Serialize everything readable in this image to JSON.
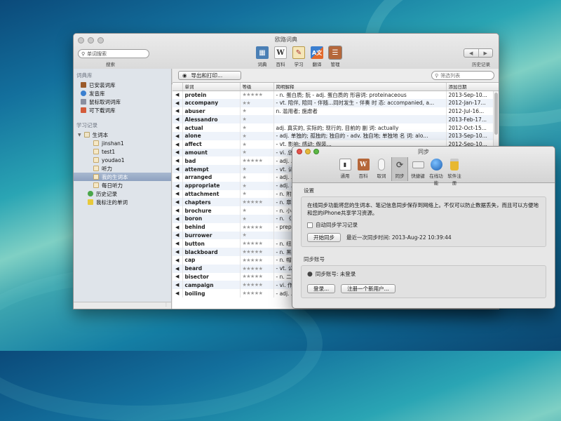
{
  "app": {
    "title": "欧路词典"
  },
  "toolbar": {
    "search_placeholder": "单词搜索",
    "search_caption": "搜索",
    "history_caption": "历史记录",
    "back": "◀",
    "forward": "▶",
    "buttons": [
      {
        "label": "词典",
        "icon": "dictionary-icon"
      },
      {
        "label": "百科",
        "icon": "wikipedia-icon"
      },
      {
        "label": "学习",
        "icon": "study-icon"
      },
      {
        "label": "翻译",
        "icon": "translate-icon"
      },
      {
        "label": "管理",
        "icon": "manage-icon"
      }
    ]
  },
  "sidebar": {
    "section1": "词典库",
    "lib_items": [
      "已安装词库",
      "发音库",
      "鼠标取词词库",
      "可下载词库"
    ],
    "section2": "学习记录",
    "vocab_root": "生词本",
    "vocab_items": [
      "jinshan1",
      "test1",
      "youdao1",
      "听力",
      "我的生词本",
      "每日听力"
    ],
    "other_items": [
      "历史记录",
      "我标注的单词"
    ],
    "selected": "我的生词本"
  },
  "main": {
    "export_label": "导出和打印...",
    "filter_placeholder": "筛选列表",
    "columns": [
      "",
      "单词",
      "等级",
      "简明解释",
      "添加日期"
    ],
    "rows": [
      {
        "word": "protein",
        "stars": "★★★★★",
        "def": "- n. 蛋白质; 朊 - adj. 蛋白质的 形容词: proteinaceous",
        "date": "2013-Sep-10..."
      },
      {
        "word": "accompany",
        "stars": "★★",
        "def": "- vt. 陪伴, 陪同 - 伴随...同时发生 - 伴奏 时 态: accompanied, a...",
        "date": "2012-Jan-17..."
      },
      {
        "word": "abuser",
        "stars": "★",
        "def": "n. 滥用者; 施虐者",
        "date": "2012-Jul-16..."
      },
      {
        "word": "Alessandro",
        "stars": "★",
        "def": "",
        "date": "2013-Feb-17..."
      },
      {
        "word": "actual",
        "stars": "★",
        "def": "adj. 真实的, 实际的; 现行的, 目前的 副 词: actually",
        "date": "2012-Oct-15..."
      },
      {
        "word": "alone",
        "stars": "★",
        "def": "- adj. 单独的; 孤独的; 独自的 - adv. 独自地; 单独地 名 词: alo...",
        "date": "2013-Sep-10..."
      },
      {
        "word": "affect",
        "stars": "★",
        "def": "- vt. 影响; 感动; 假装...",
        "date": "2012-Sep-10..."
      },
      {
        "word": "amount",
        "stars": "★",
        "def": "- vi. 总计...",
        "date": "2012-Sep-16..."
      },
      {
        "word": "bad",
        "stars": "★★★★★",
        "def": "- adj. ...",
        "date": ""
      },
      {
        "word": "attempt",
        "stars": "★",
        "def": "- vt. 试...",
        "date": ""
      },
      {
        "word": "arranged",
        "stars": "★",
        "def": "- adj. ...",
        "date": ""
      },
      {
        "word": "appropriate",
        "stars": "★",
        "def": "- adj. ...",
        "date": ""
      },
      {
        "word": "attachment",
        "stars": "★",
        "def": "- n. 附...",
        "date": ""
      },
      {
        "word": "chapters",
        "stars": "★★★★★",
        "def": "- n. 章...",
        "date": ""
      },
      {
        "word": "brochure",
        "stars": "★",
        "def": "- n. 小...",
        "date": ""
      },
      {
        "word": "boron",
        "stars": "★",
        "def": "- n. 《化...",
        "date": ""
      },
      {
        "word": "behind",
        "stars": "★★★★★",
        "def": "- prep...",
        "date": ""
      },
      {
        "word": "burrower",
        "stars": "★",
        "def": "",
        "date": ""
      },
      {
        "word": "button",
        "stars": "★★★★★",
        "def": "- n. 纽...",
        "date": ""
      },
      {
        "word": "blackboard",
        "stars": "★★★★★",
        "def": "- n. 黑板...",
        "date": ""
      },
      {
        "word": "cap",
        "stars": "★★★★★",
        "def": "- n. 帽...",
        "date": ""
      },
      {
        "word": "beard",
        "stars": "★★★★★",
        "def": "- vt. 公...",
        "date": ""
      },
      {
        "word": "bisector",
        "stars": "★★★★★",
        "def": "- n. 二等...",
        "date": ""
      },
      {
        "word": "campaign",
        "stars": "★★★★★",
        "def": "- vi. 作...",
        "date": ""
      },
      {
        "word": "boiling",
        "stars": "★★★★★",
        "def": "- adj. ...",
        "date": ""
      }
    ]
  },
  "sync_dialog": {
    "title": "同步",
    "tabs": [
      {
        "label": "通用",
        "icon": "switch-icon"
      },
      {
        "label": "百科",
        "icon": "wiki-icon"
      },
      {
        "label": "取词",
        "icon": "mouse-icon"
      },
      {
        "label": "同步",
        "icon": "sync-icon"
      },
      {
        "label": "快捷键",
        "icon": "keyboard-icon"
      },
      {
        "label": "在线功能",
        "icon": "globe-icon"
      },
      {
        "label": "软件注册",
        "icon": "lock-icon"
      }
    ],
    "settings_label": "设置",
    "description": "在线同步功能将您的生词本、笔记信息同步保存到网络上。不仅可以防止数据丢失，而且可以方便地和您的iPhone共享学习资源。",
    "auto_sync_label": "自动同步学习记录",
    "start_sync_button": "开始同步",
    "last_sync_text": "最近一次同步时间: 2013-Aug-22 10:39:44",
    "account_label": "同步账号",
    "account_status": "同步账号:  未登录",
    "login_button": "登录...",
    "register_button": "注册一个新用户..."
  }
}
